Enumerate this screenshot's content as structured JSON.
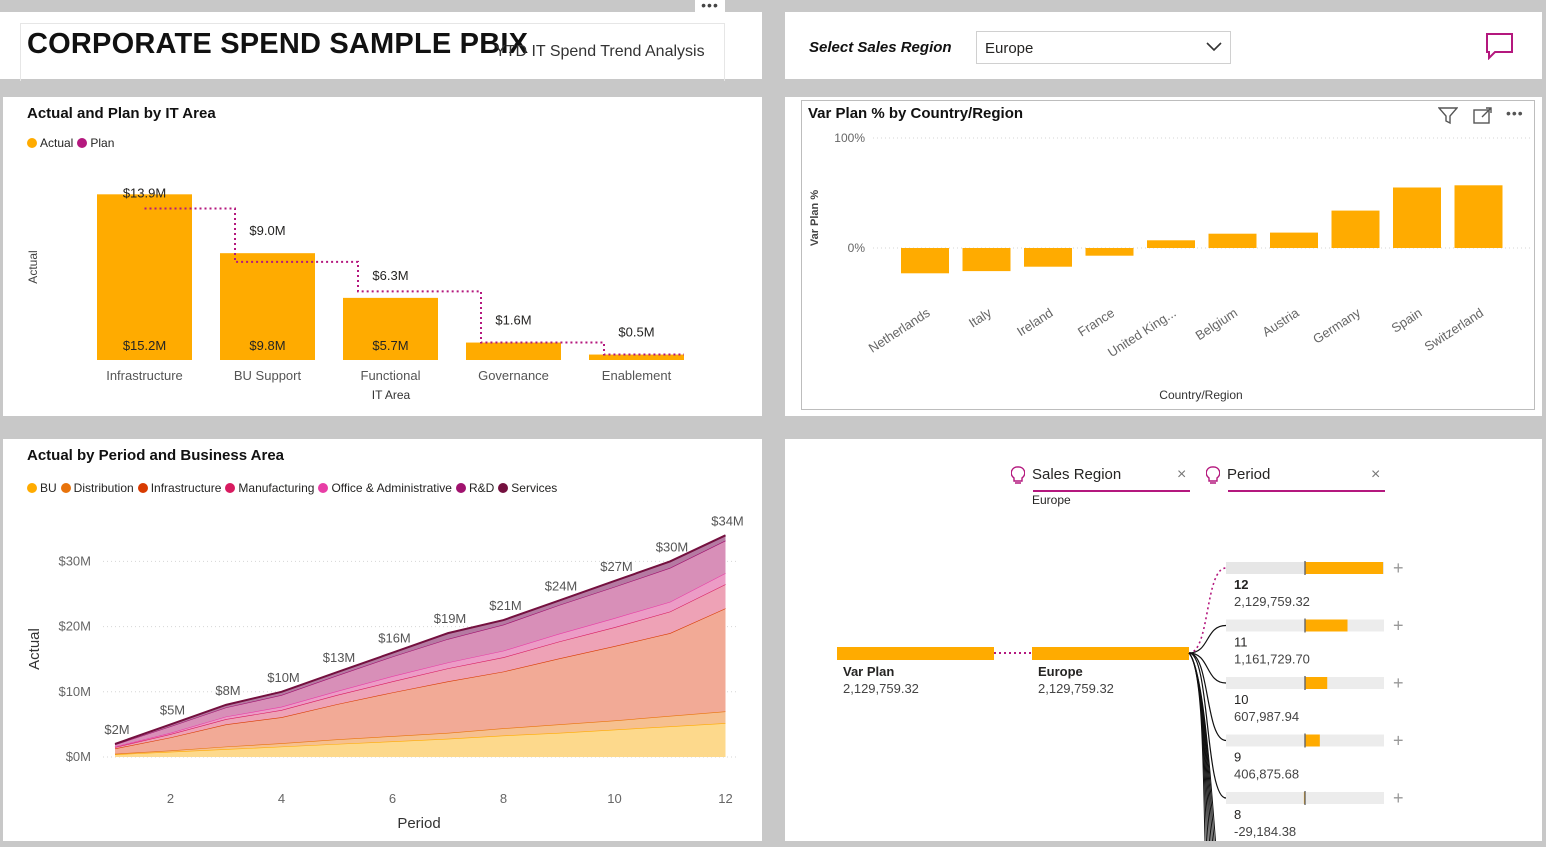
{
  "header": {
    "title": "CORPORATE SPEND SAMPLE PBIX",
    "subtitle": "YTD IT Spend Trend Analysis",
    "more_icon": "ellipsis-icon"
  },
  "slicer": {
    "label": "Select Sales Region",
    "selected": "Europe",
    "chevron_icon": "chevron-down-icon",
    "comment_icon": "comment-icon",
    "accent": "#b4187e"
  },
  "chart_actual_plan": {
    "title": "Actual and Plan by IT Area",
    "legend": [
      {
        "name": "Actual",
        "color": "#ffab00"
      },
      {
        "name": "Plan",
        "color": "#b4187e"
      }
    ],
    "chart_data": {
      "type": "bar",
      "categories": [
        "Infrastructure",
        "BU Support",
        "Functional",
        "Governance",
        "Enablement"
      ],
      "xlabel": "IT Area",
      "ylabel": "Actual",
      "series": [
        {
          "name": "Actual",
          "values": [
            15.2,
            9.8,
            5.7,
            1.6,
            0.5
          ],
          "labels": [
            "$15.2M",
            "$9.8M",
            "$5.7M",
            "$1.6M",
            "$0.5M"
          ]
        },
        {
          "name": "Plan",
          "values": [
            13.9,
            9.0,
            6.3,
            1.6,
            0.5
          ],
          "labels": [
            "$13.9M",
            "$9.0M",
            "$6.3M",
            "$1.6M",
            "$0.5M"
          ]
        }
      ]
    }
  },
  "chart_var_plan": {
    "title": "Var Plan % by Country/Region",
    "icons": [
      "filter-icon",
      "focus-mode-icon",
      "more-options-icon"
    ],
    "chart_data": {
      "type": "bar",
      "categories": [
        "Netherlands",
        "Italy",
        "Ireland",
        "France",
        "United King...",
        "Belgium",
        "Austria",
        "Germany",
        "Spain",
        "Switzerland"
      ],
      "values": [
        -23,
        -21,
        -17,
        -7,
        7,
        13,
        14,
        34,
        55,
        57
      ],
      "xlabel": "Country/Region",
      "ylabel": "Var Plan %",
      "yticks": [
        "100%",
        "0%"
      ],
      "ylim": [
        -30,
        100
      ],
      "grid": true
    }
  },
  "chart_area": {
    "title": "Actual by Period and Business Area",
    "legend": [
      {
        "name": "BU",
        "color": "#ffab00"
      },
      {
        "name": "Distribution",
        "color": "#e8730b"
      },
      {
        "name": "Infrastructure",
        "color": "#d83b01"
      },
      {
        "name": "Manufacturing",
        "color": "#d81b60"
      },
      {
        "name": "Office & Administrative",
        "color": "#e83ea6"
      },
      {
        "name": "R&D",
        "color": "#a0126e"
      },
      {
        "name": "Services",
        "color": "#74103f"
      }
    ],
    "chart_data": {
      "type": "area",
      "stacked": true,
      "x": [
        1,
        2,
        3,
        4,
        5,
        6,
        7,
        8,
        9,
        10,
        11,
        12
      ],
      "xticks": [
        2,
        4,
        6,
        8,
        10,
        12
      ],
      "yticks": [
        "$0M",
        "$10M",
        "$20M",
        "$30M"
      ],
      "ylim": [
        0,
        36
      ],
      "xlabel": "Period",
      "ylabel": "Actual",
      "total_labels": [
        "$2M",
        "$5M",
        "$8M",
        "$10M",
        "$13M",
        "$16M",
        "$19M",
        "$21M",
        "$24M",
        "$27M",
        "$30M",
        "$34M"
      ],
      "series": [
        {
          "name": "BU",
          "values": [
            0.4,
            0.8,
            1.2,
            1.6,
            2.0,
            2.4,
            2.8,
            3.3,
            3.7,
            4.2,
            4.7,
            5.2
          ]
        },
        {
          "name": "Distribution",
          "values": [
            0.1,
            0.2,
            0.4,
            0.5,
            0.7,
            0.8,
            0.9,
            1.1,
            1.3,
            1.4,
            1.6,
            1.8
          ]
        },
        {
          "name": "Infrastructure",
          "values": [
            0.8,
            2.0,
            3.4,
            4.0,
            5.4,
            6.7,
            7.9,
            8.7,
            10.1,
            11.4,
            12.7,
            15.8
          ]
        },
        {
          "name": "Manufacturing",
          "values": [
            0.2,
            0.5,
            0.8,
            1.1,
            1.4,
            1.7,
            2.0,
            2.2,
            2.6,
            2.9,
            3.3,
            3.7
          ]
        },
        {
          "name": "Office & Administrative",
          "values": [
            0.1,
            0.2,
            0.4,
            0.5,
            0.6,
            0.8,
            0.9,
            1.0,
            1.2,
            1.4,
            1.5,
            1.7
          ]
        },
        {
          "name": "R&D",
          "values": [
            0.3,
            1.0,
            1.4,
            1.8,
            2.4,
            3.0,
            3.6,
            4.0,
            4.4,
            4.8,
            5.2,
            5.0
          ]
        },
        {
          "name": "Services",
          "values": [
            0.1,
            0.3,
            0.4,
            0.5,
            0.5,
            0.6,
            0.9,
            0.7,
            0.7,
            0.9,
            1.0,
            0.8
          ]
        }
      ]
    }
  },
  "decomp_tree": {
    "fields": [
      {
        "label": "Sales Region",
        "value": "Europe",
        "icon": "lightbulb-icon",
        "close_icon": "close-icon"
      },
      {
        "label": "Period",
        "value": "",
        "icon": "lightbulb-icon",
        "close_icon": "close-icon"
      }
    ],
    "root": {
      "label": "Var Plan",
      "value": "2,129,759.32"
    },
    "level1": {
      "label": "Europe",
      "value": "2,129,759.32"
    },
    "level2": [
      {
        "label": "12",
        "value": "2,129,759.32",
        "fraction": 1.0,
        "selected": true
      },
      {
        "label": "11",
        "value": "1,161,729.70",
        "fraction": 0.545
      },
      {
        "label": "10",
        "value": "607,987.94",
        "fraction": 0.285
      },
      {
        "label": "9",
        "value": "406,875.68",
        "fraction": 0.19
      },
      {
        "label": "8",
        "value": "-29,184.38",
        "fraction": -0.014
      }
    ],
    "expand_icon": "plus-icon"
  }
}
